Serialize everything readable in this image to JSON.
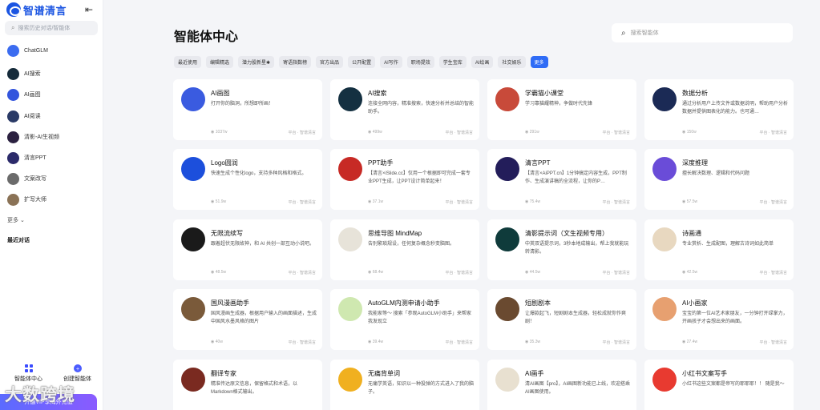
{
  "sidebar": {
    "logo_text": "智谱清言",
    "search_placeholder": "搜索历史对话/智能体",
    "items": [
      {
        "label": "ChatGLM",
        "color": "#3b6cf0"
      },
      {
        "label": "AI搜索",
        "color": "#152a3a"
      },
      {
        "label": "AI画图",
        "color": "#3355dd"
      },
      {
        "label": "AI阅读",
        "color": "#2a3a66"
      },
      {
        "label": "清影-AI生视频",
        "color": "#2b2140"
      },
      {
        "label": "清言PPT",
        "color": "#2b2a6a"
      },
      {
        "label": "文案改写",
        "color": "#6b6b6b"
      },
      {
        "label": "扩写大师",
        "color": "#8a7256"
      }
    ],
    "more_label": "更多",
    "recent_label": "最近对话",
    "bottom": {
      "agents_label": "智能体中心",
      "create_label": "创建智能体"
    },
    "vip_label": "开通VIP享海外充值"
  },
  "watermark": "大数跨境",
  "main": {
    "title": "智能体中心",
    "search_placeholder": "搜索智能体",
    "tabs": [
      "最近使用",
      "编辑精选",
      "潜力股新星✱",
      "寄语指数榜",
      "官方出品",
      "公开配置",
      "AI写作",
      "职场提效",
      "学生宝库",
      "AI绘画",
      "社交娱乐",
      "更多"
    ],
    "active_tab": 11,
    "cards": [
      {
        "name": "AI画图",
        "desc": "打开你的脑洞，所想即所画！",
        "count": "1037w",
        "color": "#3a5be0"
      },
      {
        "name": "AI搜索",
        "desc": "连接全网内容，精准搜索，快速分析并总结的智能助手。",
        "count": "499w",
        "color": "#143041"
      },
      {
        "name": "学霸猫小课堂",
        "desc": "学习靠猫耀精神，争做时代先锋",
        "count": "291w",
        "color": "#c84a3a"
      },
      {
        "name": "数据分析",
        "desc": "通过分析用户上传文件或数据说明，帮助用户分析数据并提供图表化的能力。也可通…",
        "count": "150w",
        "color": "#1b2a55"
      },
      {
        "name": "Logo圆润",
        "desc": "快速生成个性化logo，支持多种风格和格式。",
        "count": "51.9w",
        "color": "#1c4fdc"
      },
      {
        "name": "PPT助手",
        "desc": "【清言×iSlide.cc】仅用一个根据即可完成一套专业PPT生成，让PPT设计简单起来！",
        "count": "37.1w",
        "color": "#c72a25"
      },
      {
        "name": "清言PPT",
        "desc": "【清言×AiPPT.cn】1分钟搞定内容生成，PPT制作、生成演讲稿的全流程，让你的P…",
        "count": "75.4w",
        "color": "#231d5a"
      },
      {
        "name": "深度推理",
        "desc": "擅长解决数理、逻辑和代码问题",
        "count": "57.5w",
        "color": "#6a4cd8"
      },
      {
        "name": "无限流续写",
        "desc": "跟着超伏无限故神，和 AI 共创一部互动小说吧。",
        "count": "48.5w",
        "color": "#1a1a1a"
      },
      {
        "name": "思维导图 MindMap",
        "desc": "告别繁琐规设，任何复杂概念秒变脑图。",
        "count": "68.4w",
        "color": "#e7e3d9"
      },
      {
        "name": "清影提示词（文生视频专用）",
        "desc": "中英双语提示词，3秒本地成输出，帮上我就能玩转清影。",
        "count": "44.5w",
        "color": "#0f3b3b"
      },
      {
        "name": "诗画通",
        "desc": "专业赏析、生成配图，理解古诗词如此简单",
        "count": "42.5w",
        "color": "#e8d8c0"
      },
      {
        "name": "国风漫画助手",
        "desc": "国风漫画生成器，根据用户输入的画面描述，生成中国风水墨风格的图片",
        "count": "40w",
        "color": "#7a5a3a"
      },
      {
        "name": "AutoGLM内测申请小助手",
        "desc": "我能家等～ 搜索「参观AutoGLM小助手」来帮家我发现立",
        "count": "39.4w",
        "color": "#cfe8b0"
      },
      {
        "name": "短剧剧本",
        "desc": "让爆款起飞，短剧剧本生成器，轻松成就你作爽剧！",
        "count": "35.3w",
        "color": "#6a4a30"
      },
      {
        "name": "AI小画家",
        "desc": "宝宝的第一位AI艺术家朋友，一分钟打开绿掌力，开画孩子才会想出来的画面。",
        "count": "27.4w",
        "color": "#e7a070"
      },
      {
        "name": "翻译专家",
        "desc": "精准传达原文信息，保留格式和术语，以Markdown格式输出。",
        "count": "",
        "color": "#7a2a20"
      },
      {
        "name": "无痛背单词",
        "desc": "无痛学英语，知识以一种投弹的方式进入了我的脑子。",
        "count": "",
        "color": "#f0b020"
      },
      {
        "name": "AI画手",
        "desc": "清AI画图【pro】，AI画图新功能已上线，欢迎搭乘AI画图使用。",
        "count": "",
        "color": "#e8e0d0"
      },
      {
        "name": "小红书文案写手",
        "desc": "小红书这些文案都是帝写的耶耶耶！！ 随是我～",
        "count": "",
        "color": "#e83a30"
      }
    ],
    "meta_labels": {
      "l": "平台",
      "r": "智谱清言"
    }
  }
}
